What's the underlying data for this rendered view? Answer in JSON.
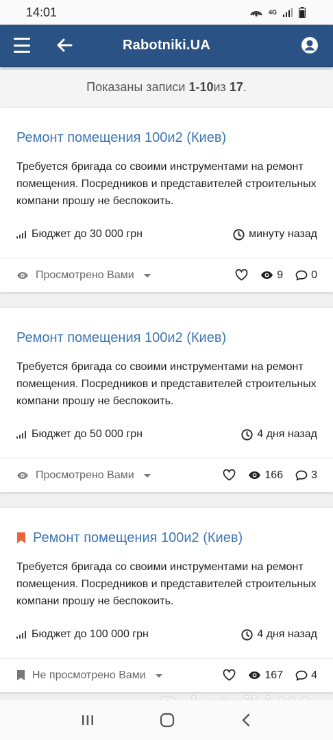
{
  "status_bar": {
    "time": "14:01",
    "network": "4G"
  },
  "app_bar": {
    "title": "Rabotniki.UA"
  },
  "pager": {
    "prefix": "Показаны записи ",
    "range": "1-10",
    "middle": " из ",
    "total": "17",
    "suffix": "."
  },
  "listings": [
    {
      "title": "Ремонт помещения 100и2 (Киев)",
      "bookmarked": false,
      "description": "Требуется бригада со своими инструментами на ремонт помещения. Посредников и представителей строительных компани прошу не беспокоить.",
      "budget": "Бюджет до 30 000 грн",
      "time": "минуту назад",
      "viewed_status": "Просмотрено Вами",
      "views": "9",
      "comments": "0"
    },
    {
      "title": "Ремонт помещения 100и2 (Киев)",
      "bookmarked": false,
      "description": "Требуется бригада со своими инструментами на ремонт помещения. Посредников и представителей строительных компани прошу не беспокоить.",
      "budget": "Бюджет до 50 000 грн",
      "time": "4 дня назад",
      "viewed_status": "Просмотрено Вами",
      "views": "166",
      "comments": "3"
    },
    {
      "title": "Ремонт помещения 100и2 (Киев)",
      "bookmarked": true,
      "description": "Требуется бригада со своими инструментами на ремонт помещения. Посредников и представителей строительных компани прошу не беспокоить.",
      "budget": "Бюджет до 100 000 грн",
      "time": "4 дня назад",
      "viewed_status": "Не просмотрено Вами",
      "views": "167",
      "comments": "4"
    }
  ],
  "watermark": "Rabotniki.UA",
  "colors": {
    "app_bar": "#2b5285",
    "title_link": "#3f77b3",
    "bookmark": "#e8643c"
  }
}
